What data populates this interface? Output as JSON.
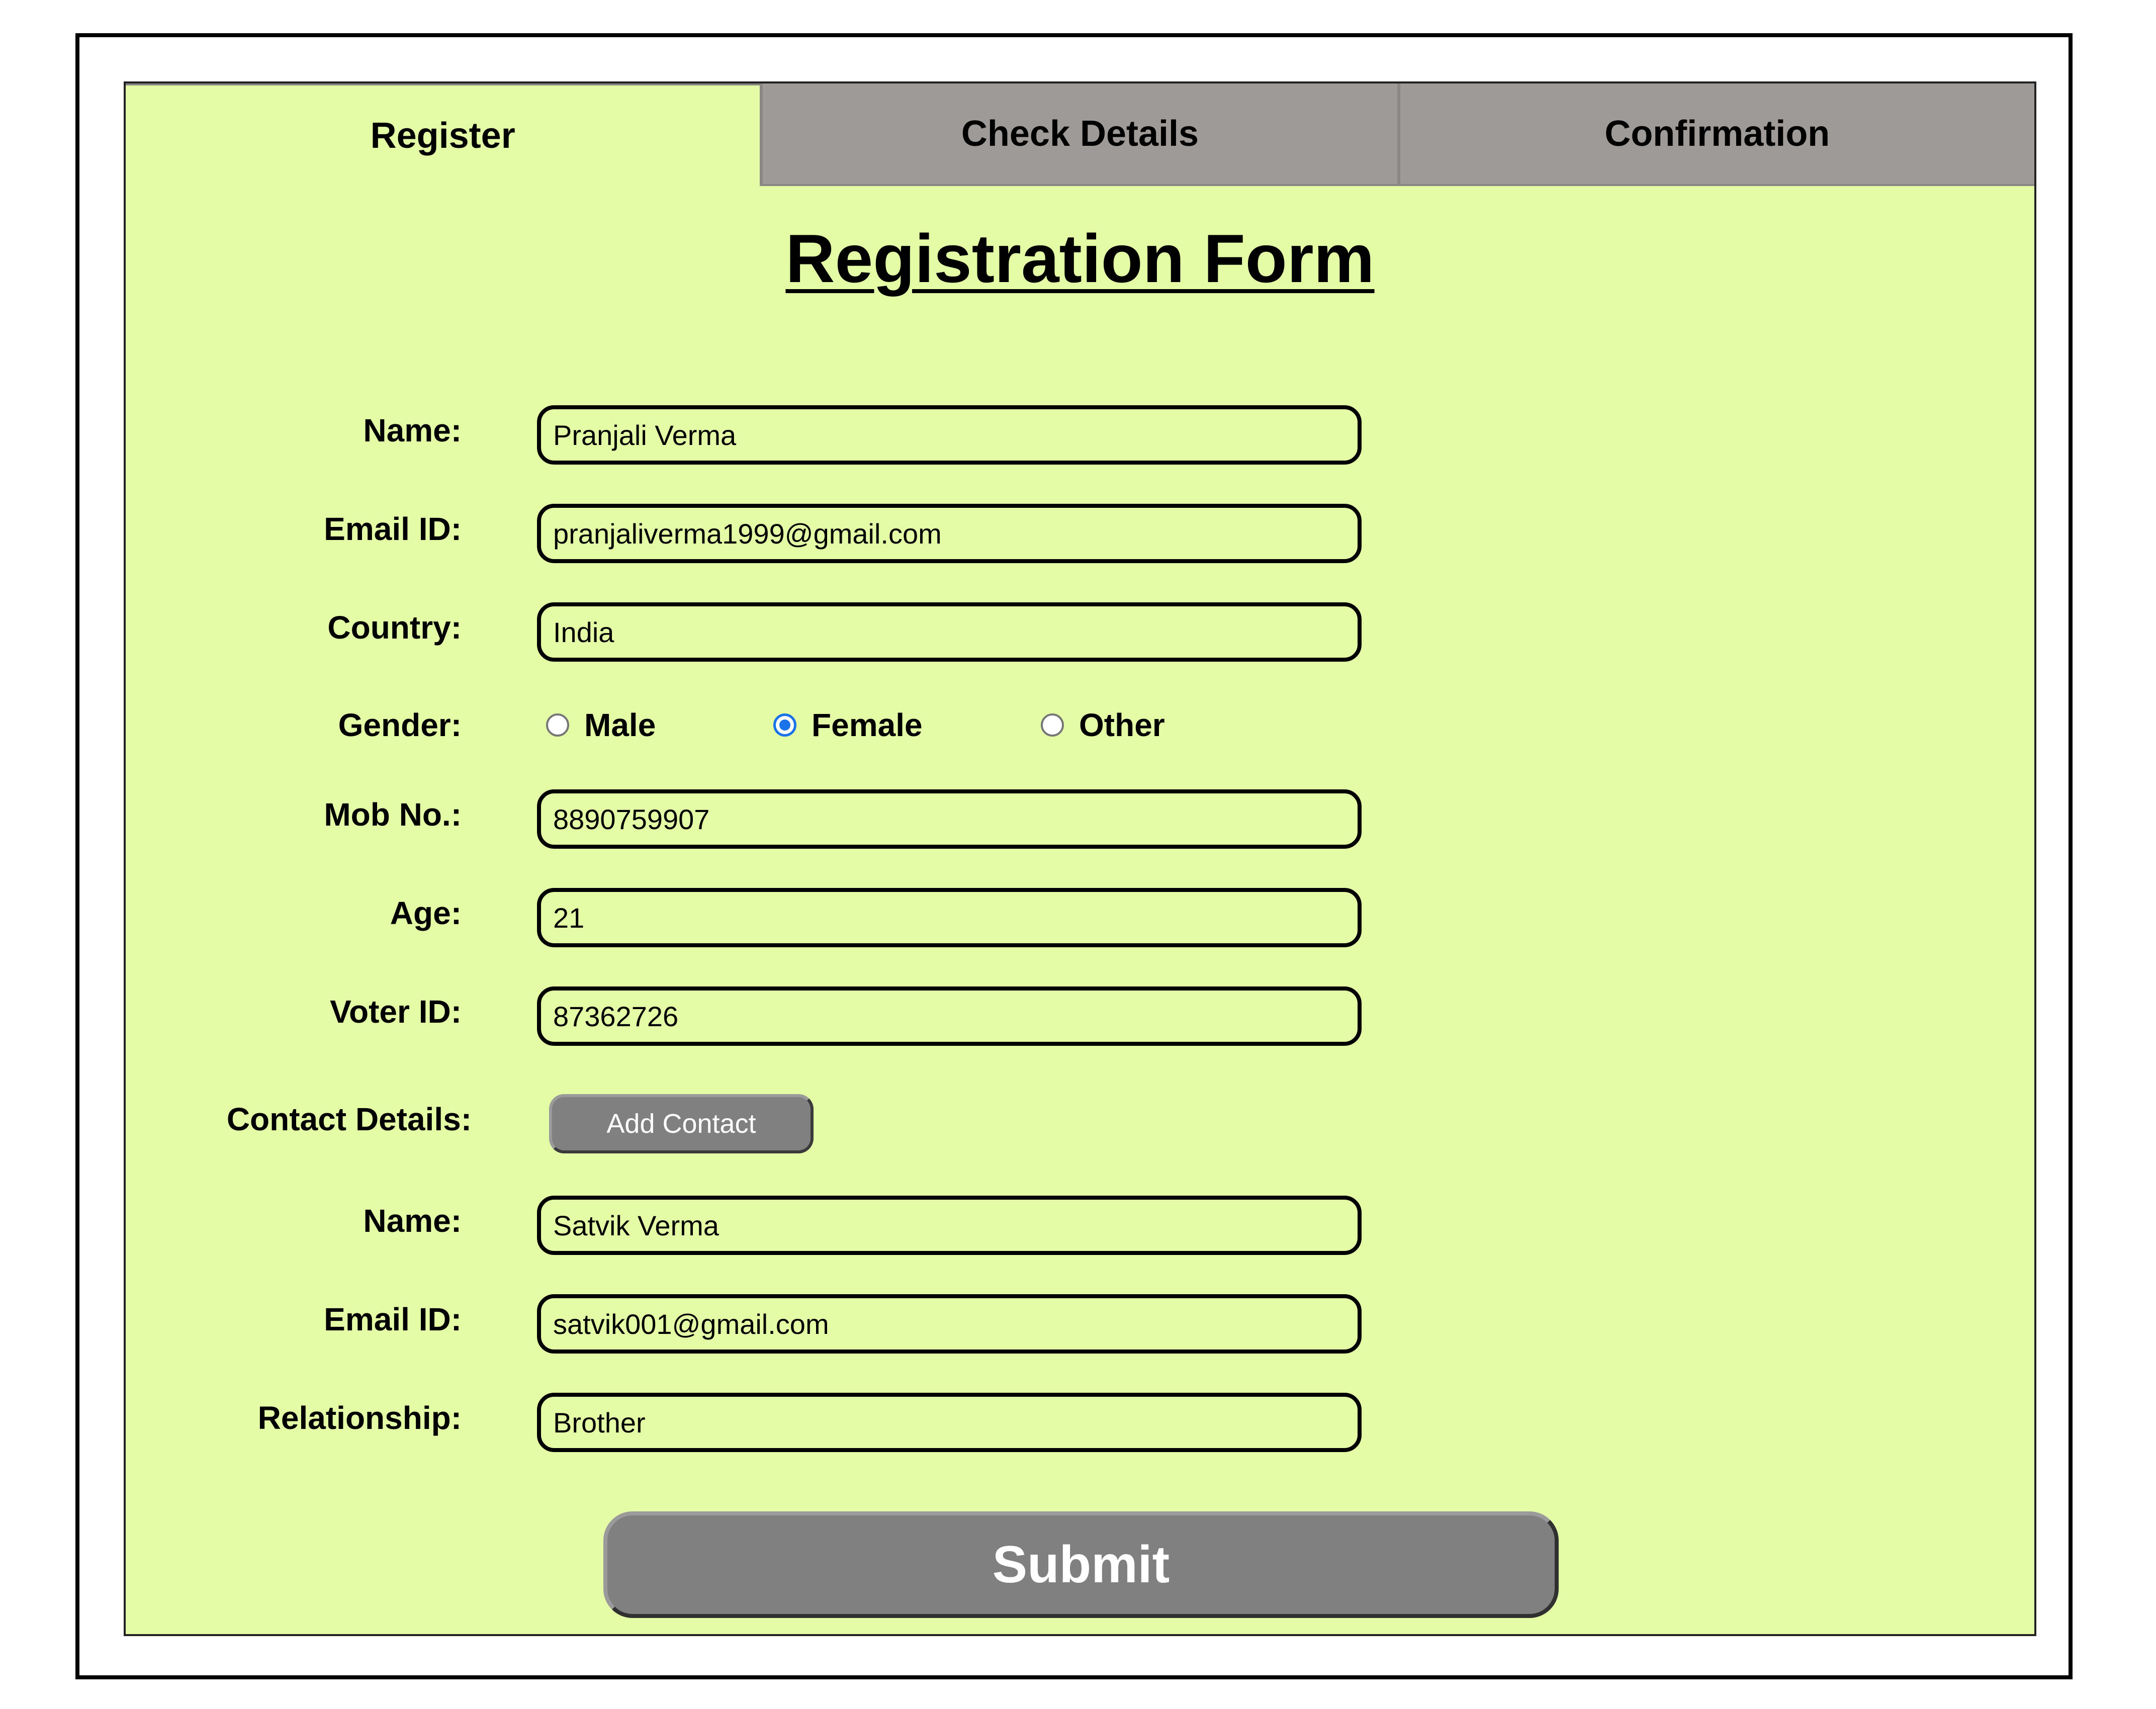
{
  "tabs": [
    {
      "label": "Register",
      "active": true
    },
    {
      "label": "Check Details",
      "active": false
    },
    {
      "label": "Confirmation",
      "active": false
    }
  ],
  "form": {
    "title": "Registration Form",
    "name_label": "Name:",
    "name_value": "Pranjali Verma",
    "email_label": "Email ID:",
    "email_value": "pranjaliverma1999@gmail.com",
    "country_label": "Country:",
    "country_value": "India",
    "gender_label": "Gender:",
    "gender_options": [
      "Male",
      "Female",
      "Other"
    ],
    "gender_selected": "Female",
    "mobile_label": "Mob No.:",
    "mobile_value": "8890759907",
    "age_label": "Age:",
    "age_value": "21",
    "voter_label": "Voter ID:",
    "voter_value": "87362726"
  },
  "contact": {
    "section_label": "Contact Details:",
    "add_button": "Add Contact",
    "name_label": "Name:",
    "name_value": "Satvik Verma",
    "email_label": "Email ID:",
    "email_value": "satvik001@gmail.com",
    "relationship_label": "Relationship:",
    "relationship_value": "Brother"
  },
  "submit_label": "Submit",
  "colors": {
    "panel_bg": "#e5fca6",
    "tab_inactive": "#9e9a97",
    "button_gray": "#808080",
    "radio_selected": "#1a73e8"
  }
}
